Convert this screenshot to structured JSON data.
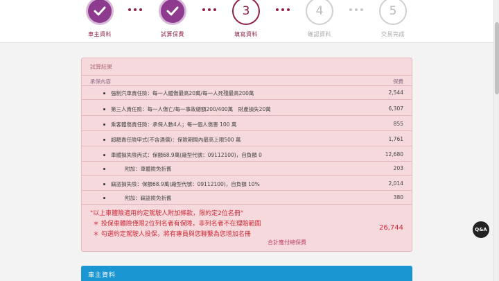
{
  "stepper": {
    "steps": [
      {
        "number": "",
        "label": "車主資料",
        "state": "done"
      },
      {
        "number": "",
        "label": "試算保費",
        "state": "done"
      },
      {
        "number": "3",
        "label": "填寫資料",
        "state": "current"
      },
      {
        "number": "4",
        "label": "確認資料",
        "state": "todo"
      },
      {
        "number": "5",
        "label": "交易完成",
        "state": "todo"
      }
    ]
  },
  "results": {
    "title": "試算結果",
    "header_item": "承保內容",
    "header_amount": "保費",
    "rows": [
      {
        "desc": "強制汽車責任險：每一人體傷最高20萬/每一人死殘最高200萬",
        "amount": "2,544"
      },
      {
        "desc": "第三人責任險：每一人傷亡/每一事故總額200/400萬　財產損失20萬",
        "amount": "6,307"
      },
      {
        "desc": "乘客體傷責任險：承保人數4人；每一個人傷害 100 萬",
        "amount": "855"
      },
      {
        "desc": "超額責任險甲式(不含酒償)：保險期間內最高上限500 萬",
        "amount": "1,761"
      },
      {
        "desc": "車體損失險丙式：保額68.9萬(廠型代號：09112100)，自負額 0",
        "amount": "12,680"
      },
      {
        "desc": "附加：車體險免折舊",
        "amount": "203"
      },
      {
        "desc": "竊盜損失險：保額68.9萬(廠型代號：09112100)，自負額 10%",
        "amount": "2,014"
      },
      {
        "desc": "附加：竊盜險免折舊",
        "amount": "380"
      }
    ],
    "notes": [
      "\"以上車體險適用約定駕駛人附加條款，限約定2位名冊\"",
      "＊ 投保車體險僅限2位列名者有保障，非列名者不在理賠範圍",
      "＊ 勾選約定駕駛人投保，將有專員與您聯繫為您增加名冊"
    ],
    "total": "26,744",
    "total_label": "合計應付總保費"
  },
  "owner_section": {
    "title": "車主資料"
  },
  "qa_button": {
    "label": "Q&A"
  },
  "colors": {
    "brand_purple": "#8e3b8f",
    "accent_maroon": "#8e1f4a",
    "panel_bg": "#f5d9dc",
    "note_red": "#d12a3a",
    "owner_blue": "#1a96d3"
  }
}
